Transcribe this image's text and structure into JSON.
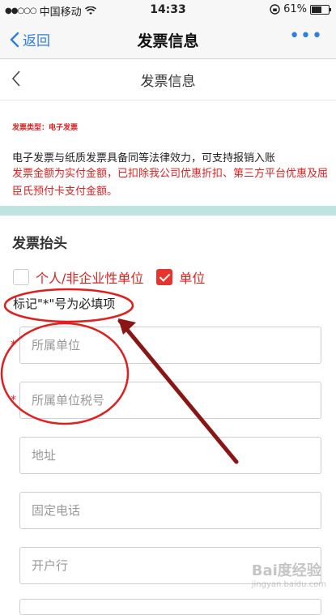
{
  "status_bar": {
    "carrier": "中国移动",
    "time": "14:33",
    "battery_percent": "61%",
    "battery_level": 0.61
  },
  "nav": {
    "back_label": "返回",
    "title": "发票信息",
    "more": "•••"
  },
  "page_header": {
    "title": "发票信息"
  },
  "invoice": {
    "type_label": "发票类型：电子发票",
    "notice_line1": "电子发票与纸质发票具备同等法律效力，可支持报销入账",
    "notice_line2": "发票金额为实付金额，已扣除我公司优惠折扣、第三方平台优惠及屈臣氏预付卡支付金额。"
  },
  "header_section": {
    "title": "发票抬头",
    "options": [
      {
        "label": "个人/非企业性单位",
        "checked": false
      },
      {
        "label": "单位",
        "checked": true
      }
    ],
    "required_note": "标记\"*\"号为必填项"
  },
  "fields": [
    {
      "placeholder": "所属单位",
      "required": true
    },
    {
      "placeholder": "所属单位税号",
      "required": true
    },
    {
      "placeholder": "地址",
      "required": false
    },
    {
      "placeholder": "固定电话",
      "required": false
    },
    {
      "placeholder": "开户行",
      "required": false
    }
  ],
  "required_mark": "*",
  "colors": {
    "accent_blue": "#2f7ee0",
    "warning_red": "#d22222",
    "checkbox_red": "#e8342c",
    "annotation_red": "#e02020",
    "arrow_dark_red": "#8b1414",
    "divider_teal": "#bfe3de"
  },
  "watermark": {
    "text": "Bai度经验",
    "sub": "jingyan.baidu.com"
  }
}
